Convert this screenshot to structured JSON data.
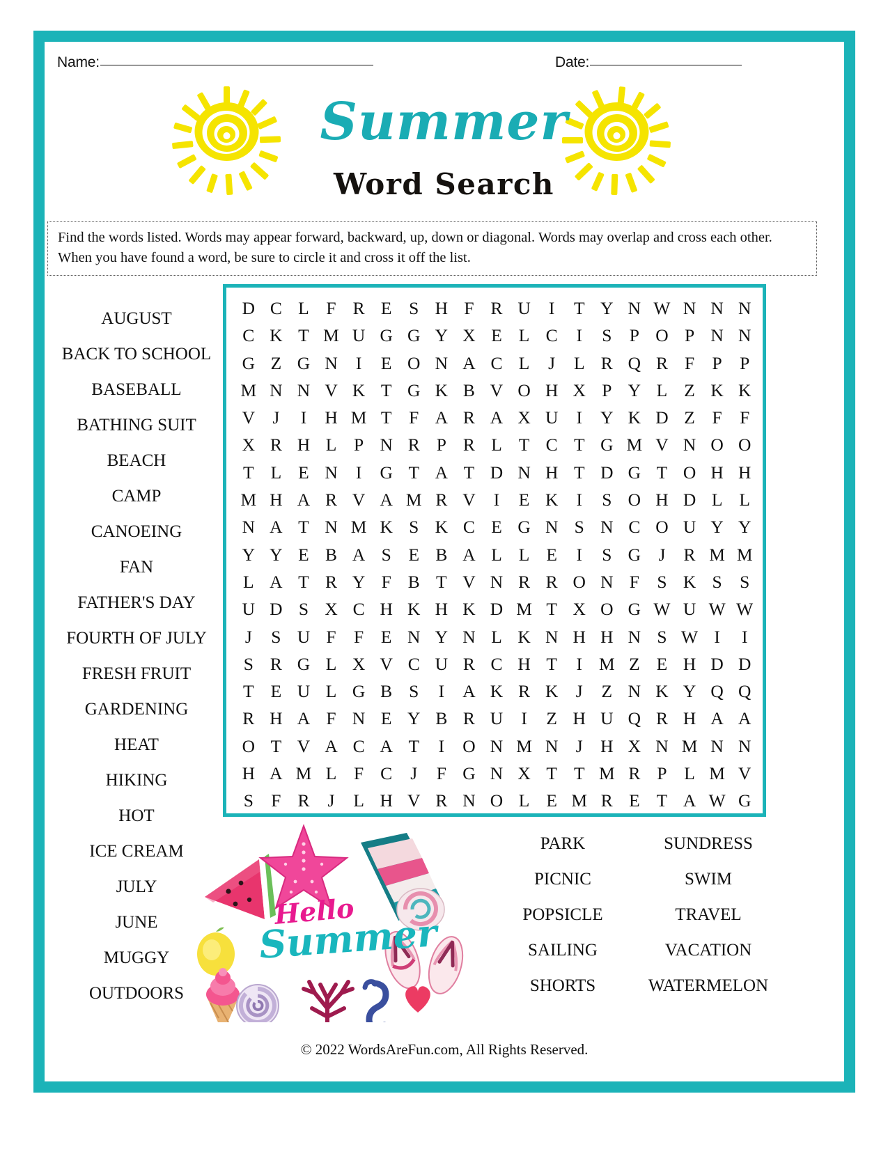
{
  "header": {
    "name_label": "Name:",
    "date_label": "Date:"
  },
  "title": {
    "script_word": "Summer",
    "subtitle": "Word Search"
  },
  "instructions": {
    "text": "Find the words listed.  Words may appear forward, backward, up, down or diagonal.  Words may overlap and cross each other.  When you have found a word, be sure to circle it and cross it off the list."
  },
  "colors": {
    "teal_border": "#1bb3b8",
    "title_teal": "#1aacb4",
    "sun_yellow": "#f5e400",
    "hello_pink": "#e81a8f",
    "text_black": "#111111"
  },
  "word_list": {
    "left_column": [
      "AUGUST",
      "BACK TO SCHOOL",
      "BASEBALL",
      "BATHING SUIT",
      "BEACH",
      "CAMP",
      "CANOEING",
      "FAN",
      "FATHER'S DAY",
      "FOURTH OF JULY",
      "FRESH FRUIT",
      "GARDENING",
      "HEAT",
      "HIKING",
      "HOT",
      "ICE CREAM",
      "JULY",
      "JUNE",
      "MUGGY",
      "OUTDOORS"
    ],
    "middle_column": [
      "PARK",
      "PICNIC",
      "POPSICLE",
      "SAILING",
      "SHORTS"
    ],
    "right_column": [
      "SUNDRESS",
      "SWIM",
      "TRAVEL",
      "VACATION",
      "WATERMELON"
    ]
  },
  "puzzle_grid": {
    "rows": 19,
    "cols": 19,
    "letters": [
      [
        "D",
        "C",
        "L",
        "F",
        "R",
        "E",
        "S",
        "H",
        "F",
        "R",
        "U",
        "I",
        "T",
        "Y",
        "N",
        "W",
        "N",
        "N",
        "N"
      ],
      [
        "C",
        "K",
        "T",
        "M",
        "U",
        "G",
        "G",
        "Y",
        "X",
        "E",
        "L",
        "C",
        "I",
        "S",
        "P",
        "O",
        "P",
        "N",
        "N"
      ],
      [
        "G",
        "Z",
        "G",
        "N",
        "I",
        "E",
        "O",
        "N",
        "A",
        "C",
        "L",
        "J",
        "L",
        "R",
        "Q",
        "R",
        "F",
        "P",
        "P"
      ],
      [
        "M",
        "N",
        "N",
        "V",
        "K",
        "T",
        "G",
        "K",
        "B",
        "V",
        "O",
        "H",
        "X",
        "P",
        "Y",
        "L",
        "Z",
        "K",
        "K"
      ],
      [
        "V",
        "J",
        "I",
        "H",
        "M",
        "T",
        "F",
        "A",
        "R",
        "A",
        "X",
        "U",
        "I",
        "Y",
        "K",
        "D",
        "Z",
        "F",
        "F"
      ],
      [
        "X",
        "R",
        "H",
        "L",
        "P",
        "N",
        "R",
        "P",
        "R",
        "L",
        "T",
        "C",
        "T",
        "G",
        "M",
        "V",
        "N",
        "O",
        "O"
      ],
      [
        "T",
        "L",
        "E",
        "N",
        "I",
        "G",
        "T",
        "A",
        "T",
        "D",
        "N",
        "H",
        "T",
        "D",
        "G",
        "T",
        "O",
        "H",
        "H"
      ],
      [
        "M",
        "H",
        "A",
        "R",
        "V",
        "A",
        "M",
        "R",
        "V",
        "I",
        "E",
        "K",
        "I",
        "S",
        "O",
        "H",
        "D",
        "L",
        "L"
      ],
      [
        "N",
        "A",
        "T",
        "N",
        "M",
        "K",
        "S",
        "K",
        "C",
        "E",
        "G",
        "N",
        "S",
        "N",
        "C",
        "O",
        "U",
        "Y",
        "Y"
      ],
      [
        "Y",
        "Y",
        "E",
        "B",
        "A",
        "S",
        "E",
        "B",
        "A",
        "L",
        "L",
        "E",
        "I",
        "S",
        "G",
        "J",
        "R",
        "M",
        "M"
      ],
      [
        "L",
        "A",
        "T",
        "R",
        "Y",
        "F",
        "B",
        "T",
        "V",
        "N",
        "R",
        "R",
        "O",
        "N",
        "F",
        "S",
        "K",
        "S",
        "S"
      ],
      [
        "U",
        "D",
        "S",
        "X",
        "C",
        "H",
        "K",
        "H",
        "K",
        "D",
        "M",
        "T",
        "X",
        "O",
        "G",
        "W",
        "U",
        "W",
        "W"
      ],
      [
        "J",
        "S",
        "U",
        "F",
        "F",
        "E",
        "N",
        "Y",
        "N",
        "L",
        "K",
        "N",
        "H",
        "H",
        "N",
        "S",
        "W",
        "I",
        "I"
      ],
      [
        "S",
        "R",
        "G",
        "L",
        "X",
        "V",
        "C",
        "U",
        "R",
        "C",
        "H",
        "T",
        "I",
        "M",
        "Z",
        "E",
        "H",
        "D",
        "D"
      ],
      [
        "T",
        "E",
        "U",
        "L",
        "G",
        "B",
        "S",
        "I",
        "A",
        "K",
        "R",
        "K",
        "J",
        "Z",
        "N",
        "K",
        "Y",
        "Q",
        "Q"
      ],
      [
        "R",
        "H",
        "A",
        "F",
        "N",
        "E",
        "Y",
        "B",
        "R",
        "U",
        "I",
        "Z",
        "H",
        "U",
        "Q",
        "R",
        "H",
        "A",
        "A"
      ],
      [
        "O",
        "T",
        "V",
        "A",
        "C",
        "A",
        "T",
        "I",
        "O",
        "N",
        "M",
        "N",
        "J",
        "H",
        "X",
        "N",
        "M",
        "N",
        "N"
      ],
      [
        "H",
        "A",
        "M",
        "L",
        "F",
        "C",
        "J",
        "F",
        "G",
        "N",
        "X",
        "T",
        "T",
        "M",
        "R",
        "P",
        "L",
        "M",
        "V"
      ],
      [
        "S",
        "F",
        "R",
        "J",
        "L",
        "H",
        "V",
        "R",
        "N",
        "O",
        "L",
        "E",
        "M",
        "R",
        "E",
        "T",
        "A",
        "W",
        "G"
      ]
    ]
  },
  "clipart": {
    "hello_text": "Hello",
    "summer_text": "Summer",
    "items": [
      "watermelon-slice",
      "starfish",
      "rolled-beach-towel",
      "lemon",
      "ice-cream-cone",
      "flip-flops",
      "seashell",
      "coral",
      "seahorse",
      "heart"
    ]
  },
  "footer": {
    "copyright": "© 2022 WordsAreFun.com, All Rights Reserved."
  }
}
